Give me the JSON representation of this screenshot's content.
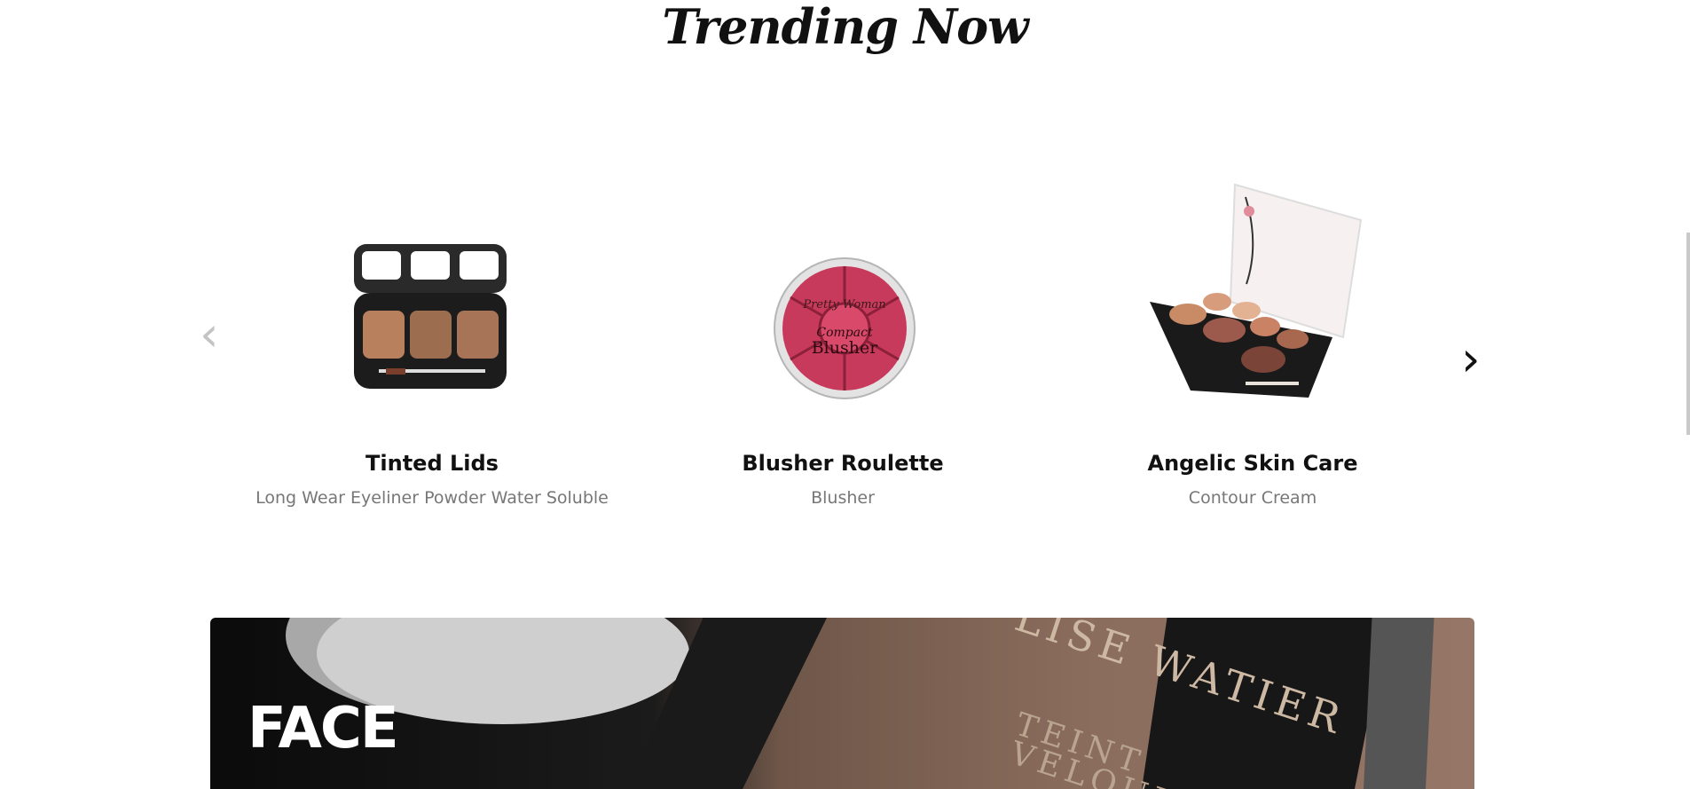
{
  "section_title": "Trending Now",
  "carousel": {
    "prev_icon": "‹",
    "next_icon": "›",
    "items": [
      {
        "name": "Tinted Lids",
        "subtitle": "Long Wear Eyeliner Powder Water Soluble",
        "image": "eyeshadow-palette"
      },
      {
        "name": "Blusher Roulette",
        "subtitle": "Blusher",
        "image": "compact-blusher"
      },
      {
        "name": "Angelic Skin Care",
        "subtitle": "Contour Cream",
        "image": "contour-palette"
      }
    ]
  },
  "blusher_product": {
    "brand_text": "Pretty Woman",
    "line1": "Compact",
    "line2": "Blusher"
  },
  "banner": {
    "label": "FACE",
    "brand_text": "LISE WATIER",
    "product_line1": "TEINT",
    "product_line2": "VELOUR"
  }
}
